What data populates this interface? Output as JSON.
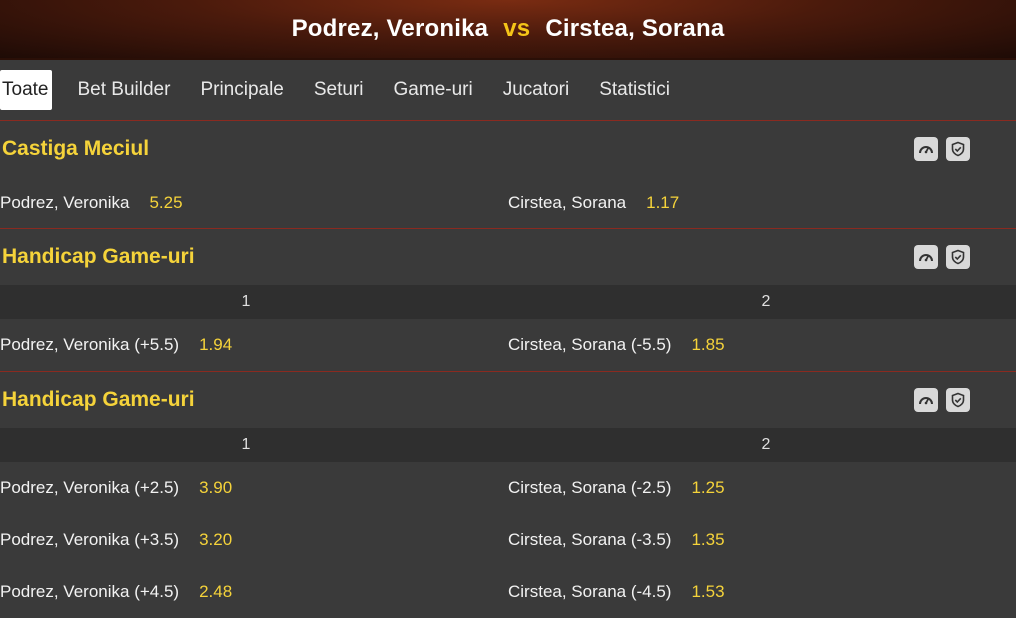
{
  "header": {
    "player1": "Podrez, Veronika",
    "vs": "vs",
    "player2": "Cirstea, Sorana"
  },
  "tabs": [
    "Toate",
    "Bet Builder",
    "Principale",
    "Seturi",
    "Game-uri",
    "Jucatori",
    "Statistici"
  ],
  "icons": {
    "stats": "speedometer-icon",
    "guarantee": "shield-check-icon"
  },
  "colors": {
    "accent": "#f5d33a",
    "divider": "#8a2a20",
    "background": "#3a3a3a"
  },
  "markets": [
    {
      "title": "Castiga Meciul",
      "columns": [],
      "rows": [
        {
          "left_name": "Podrez, Veronika",
          "left_odd": "5.25",
          "right_name": "Cirstea, Sorana",
          "right_odd": "1.17"
        }
      ]
    },
    {
      "title": "Handicap Game-uri",
      "columns": [
        "1",
        "2"
      ],
      "rows": [
        {
          "left_name": "Podrez, Veronika (+5.5)",
          "left_odd": "1.94",
          "right_name": "Cirstea, Sorana (-5.5)",
          "right_odd": "1.85"
        }
      ]
    },
    {
      "title": "Handicap Game-uri",
      "columns": [
        "1",
        "2"
      ],
      "rows": [
        {
          "left_name": "Podrez, Veronika (+2.5)",
          "left_odd": "3.90",
          "right_name": "Cirstea, Sorana (-2.5)",
          "right_odd": "1.25"
        },
        {
          "left_name": "Podrez, Veronika (+3.5)",
          "left_odd": "3.20",
          "right_name": "Cirstea, Sorana (-3.5)",
          "right_odd": "1.35"
        },
        {
          "left_name": "Podrez, Veronika (+4.5)",
          "left_odd": "2.48",
          "right_name": "Cirstea, Sorana (-4.5)",
          "right_odd": "1.53"
        }
      ]
    }
  ]
}
